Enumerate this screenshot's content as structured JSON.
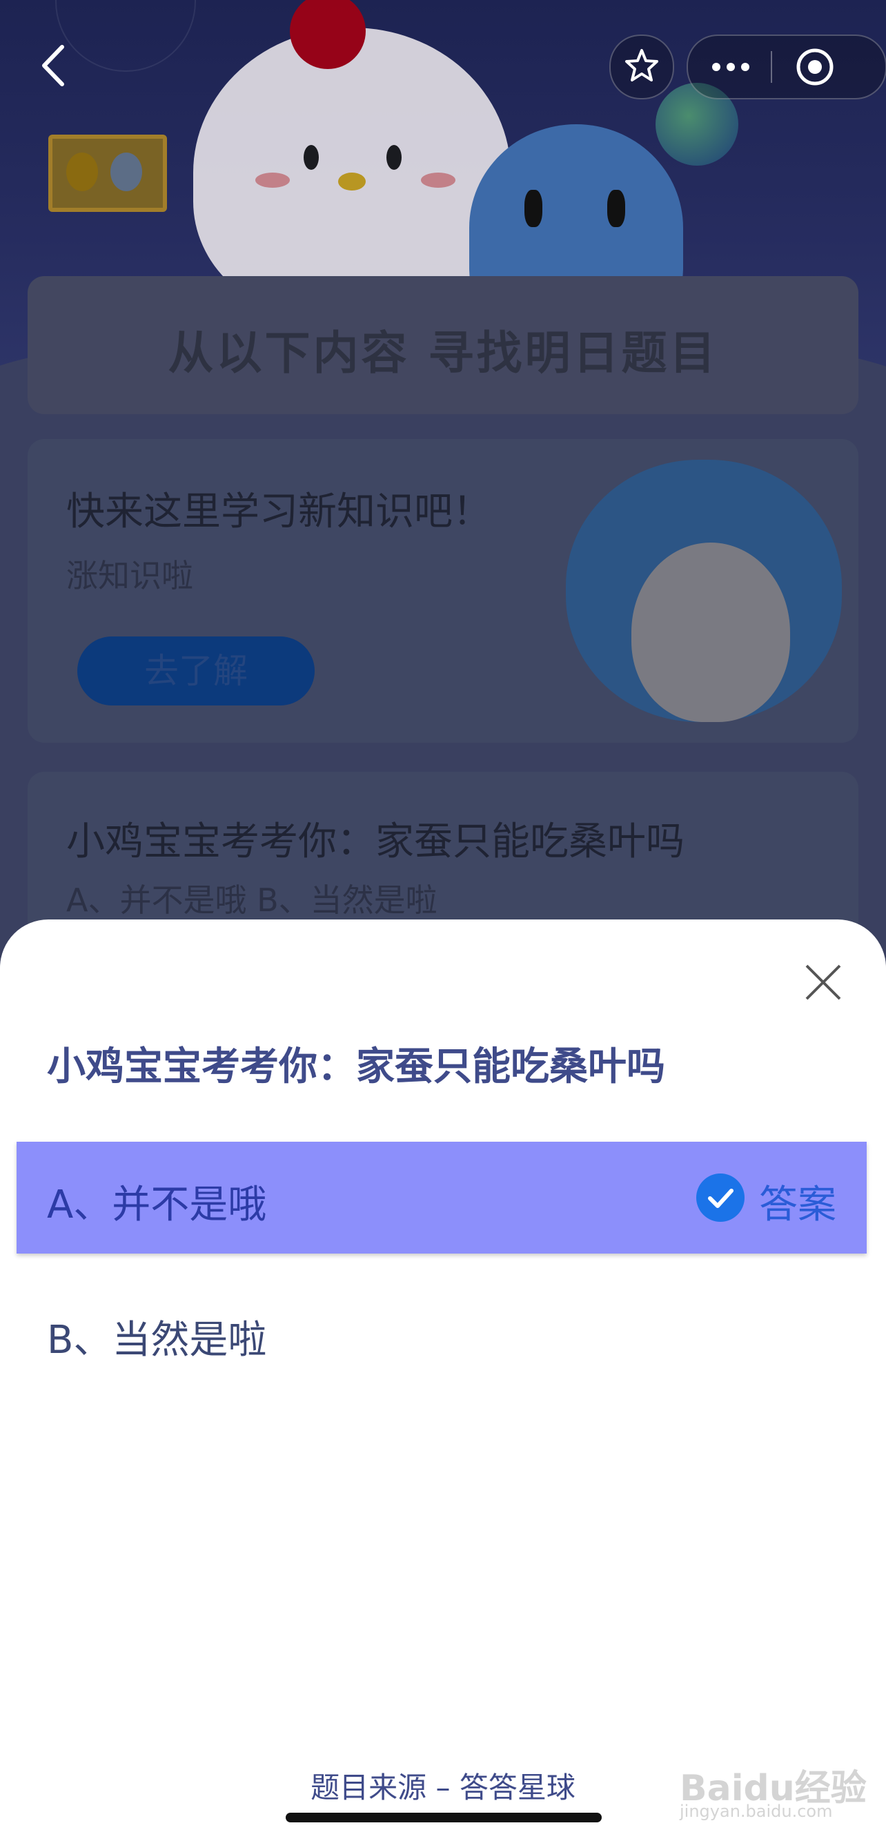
{
  "nav": {
    "back_icon": "chevron-left-icon",
    "star_icon": "star-icon",
    "more_icon": "more-dots-icon",
    "target_icon": "target-icon"
  },
  "background": {
    "section_title": "从以下内容  寻找明日题目",
    "card1": {
      "title": "快来这里学习新知识吧！",
      "subtitle": "涨知识啦",
      "button": "去了解"
    },
    "card2": {
      "title": "小鸡宝宝考考你：家蚕只能吃桑叶吗",
      "options": "A、并不是哦     B、当然是啦"
    }
  },
  "sheet": {
    "question": "小鸡宝宝考考你：家蚕只能吃桑叶吗",
    "options": [
      {
        "label": "A、并不是哦",
        "is_answer": true,
        "answer_tag": "答案"
      },
      {
        "label": "B、当然是啦",
        "is_answer": false
      }
    ],
    "source": "题目来源 – 答答星球",
    "close_icon": "close-icon"
  },
  "watermark": {
    "logo": "Baidu经验",
    "url": "jingyan.baidu.com"
  },
  "colors": {
    "selected_option_bg": "#8c8ffb",
    "question_text": "#3f4b8a",
    "check": "#1b73e8"
  }
}
